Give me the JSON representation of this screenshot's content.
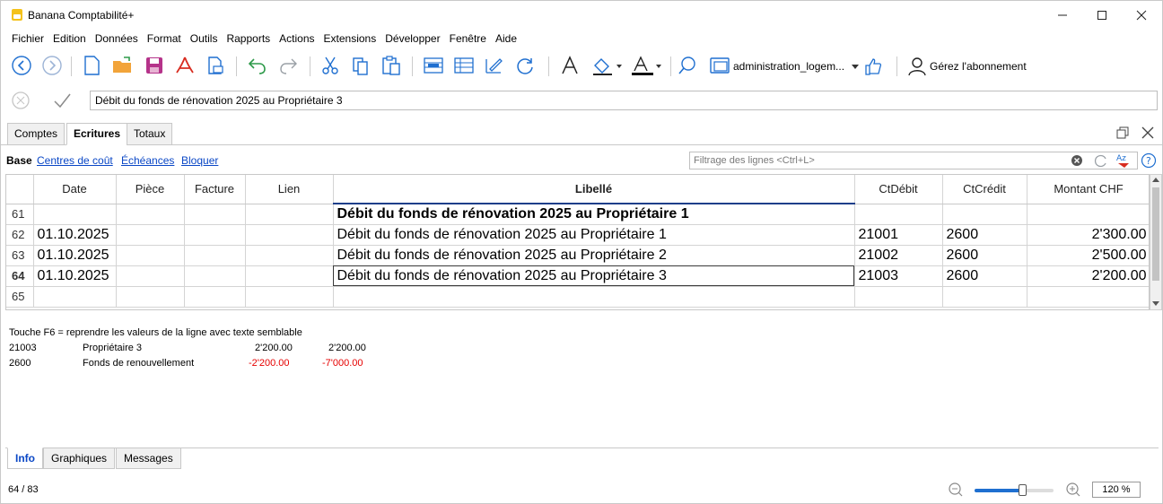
{
  "app": {
    "title": "Banana Comptabilité+"
  },
  "menu": [
    "Fichier",
    "Edition",
    "Données",
    "Format",
    "Outils",
    "Rapports",
    "Actions",
    "Extensions",
    "Développer",
    "Fenêtre",
    "Aide"
  ],
  "toolbar": {
    "document_name": "administration_logem...",
    "subscription_label": "Gérez l'abonnement"
  },
  "editbar": {
    "value": "Débit du fonds de rénovation 2025 au Propriétaire 3"
  },
  "tabs": [
    "Comptes",
    "Ecritures",
    "Totaux"
  ],
  "views": {
    "base": "Base",
    "links": [
      "Centres de coût",
      "Échéances",
      "Bloquer"
    ]
  },
  "filter": {
    "placeholder": "Filtrage des lignes <Ctrl+L>"
  },
  "table": {
    "columns": [
      "",
      "Date",
      "Pièce",
      "Facture",
      "Lien",
      "Libellé",
      "CtDébit",
      "CtCrédit",
      "Montant CHF"
    ],
    "rows": [
      {
        "num": "61",
        "date": "",
        "piece": "",
        "facture": "",
        "lien": "",
        "libelle": "Débit du fonds de rénovation 2025 au Propriétaire 1",
        "debit": "",
        "credit": "",
        "montant": ""
      },
      {
        "num": "62",
        "date": "01.10.2025",
        "piece": "",
        "facture": "",
        "lien": "",
        "libelle": "Débit du fonds de rénovation 2025 au Propriétaire 1",
        "debit": "21001",
        "credit": "2600",
        "montant": "2'300.00"
      },
      {
        "num": "63",
        "date": "01.10.2025",
        "piece": "",
        "facture": "",
        "lien": "",
        "libelle": "Débit du fonds de rénovation 2025 au Propriétaire 2",
        "debit": "21002",
        "credit": "2600",
        "montant": "2'500.00"
      },
      {
        "num": "64",
        "date": "01.10.2025",
        "piece": "",
        "facture": "",
        "lien": "",
        "libelle": "Débit du fonds de rénovation 2025 au Propriétaire 3",
        "debit": "21003",
        "credit": "2600",
        "montant": "2'200.00"
      },
      {
        "num": "65",
        "date": "",
        "piece": "",
        "facture": "",
        "lien": "",
        "libelle": "",
        "debit": "",
        "credit": "",
        "montant": ""
      }
    ]
  },
  "info": {
    "hint": "Touche F6 = reprendre les valeurs de la ligne avec texte semblable",
    "lines": [
      {
        "account": "21003",
        "desc": "Propriétaire 3",
        "amount": "2'200.00",
        "balance": "2'200.00"
      },
      {
        "account": "2600",
        "desc": "Fonds de renouvellement",
        "amount": "-2'200.00",
        "balance": "-7'000.00"
      }
    ]
  },
  "bottom_tabs": [
    "Info",
    "Graphiques",
    "Messages"
  ],
  "status": {
    "position": "64 / 83",
    "zoom": "120 %",
    "zoom_level": 0.6
  },
  "colors": {
    "link": "#0a47c6",
    "negative": "#e60000",
    "icon_blue": "#1f6fd0",
    "save_purple": "#b5338a",
    "pdf_red": "#d82c20",
    "folder_orange": "#f2a43a"
  }
}
